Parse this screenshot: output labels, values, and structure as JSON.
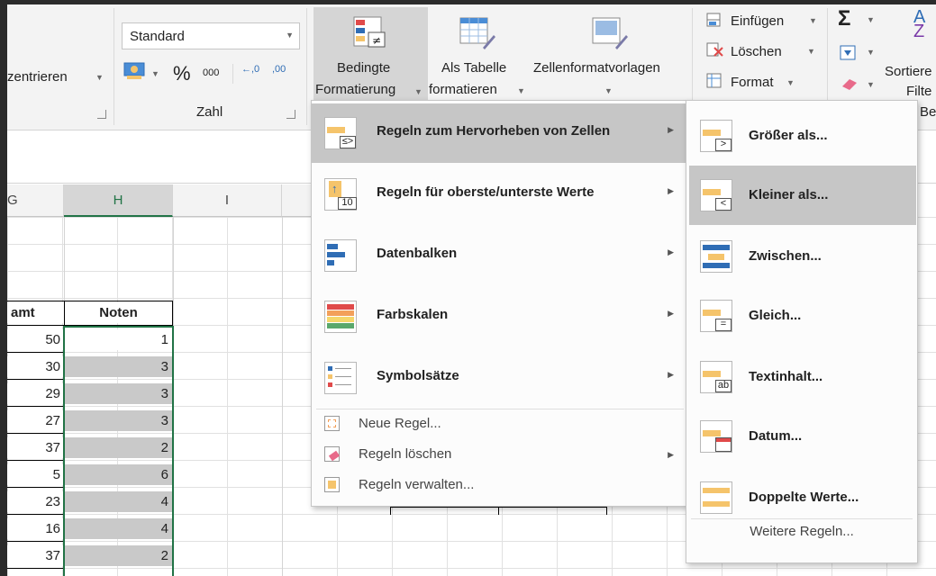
{
  "ribbon": {
    "align_partial": "zentrieren",
    "number_format": "Standard",
    "percent": "%",
    "thousands": "000",
    "dec_inc": "←,0",
    "dec_dec": ",00",
    "group_zahl": "Zahl",
    "cf_line1": "Bedingte",
    "cf_line2": "Formatierung",
    "table_line1": "Als Tabelle",
    "table_line2": "formatieren",
    "styles": "Zellenformatvorlagen",
    "insert": "Einfügen",
    "delete": "Löschen",
    "format": "Format",
    "sort_line1": "Sortiere",
    "sort_line2": "Filte",
    "group_partial": "Be"
  },
  "grid": {
    "columns": [
      "G",
      "H",
      "I"
    ],
    "header_left_partial": "amt",
    "header_noten": "Noten",
    "rows": [
      {
        "a": "50",
        "b": "1"
      },
      {
        "a": "30",
        "b": "3"
      },
      {
        "a": "29",
        "b": "3"
      },
      {
        "a": "27",
        "b": "3"
      },
      {
        "a": "37",
        "b": "2"
      },
      {
        "a": "5",
        "b": "6"
      },
      {
        "a": "23",
        "b": "4"
      },
      {
        "a": "16",
        "b": "4"
      },
      {
        "a": "37",
        "b": "2"
      }
    ],
    "hidden_partial": [
      "1",
      "1"
    ]
  },
  "menu": {
    "items": [
      {
        "label": "Regeln zum Hervorheben von Zellen",
        "underline_char": "H"
      },
      {
        "label": "Regeln für oberste/unterste Werte",
        "underline_char": "o"
      },
      {
        "label": "Datenbalken",
        "underline_char": "D"
      },
      {
        "label": "Farbskalen",
        "underline_char": "F"
      },
      {
        "label": "Symbolsätze",
        "underline_char": "S"
      }
    ],
    "small_items": [
      {
        "label": "Neue Regel..."
      },
      {
        "label": "Regeln löschen"
      },
      {
        "label": "Regeln verwalten..."
      }
    ]
  },
  "submenu": {
    "items": [
      {
        "label": "Größer als...",
        "glyph": ">"
      },
      {
        "label": "Kleiner als...",
        "glyph": "<"
      },
      {
        "label": "Zwischen...",
        "glyph": ""
      },
      {
        "label": "Gleich...",
        "glyph": "="
      },
      {
        "label": "Textinhalt...",
        "glyph": "ab"
      },
      {
        "label": "Datum...",
        "glyph": ""
      },
      {
        "label": "Doppelte Werte...",
        "glyph": ""
      }
    ],
    "more": "Weitere Regeln..."
  },
  "colors": {
    "accent_green": "#217346",
    "highlight": "#c6c6c6",
    "icon_yellow": "#f5c46b",
    "icon_blue": "#2f6db5",
    "icon_red": "#e04a4a"
  }
}
